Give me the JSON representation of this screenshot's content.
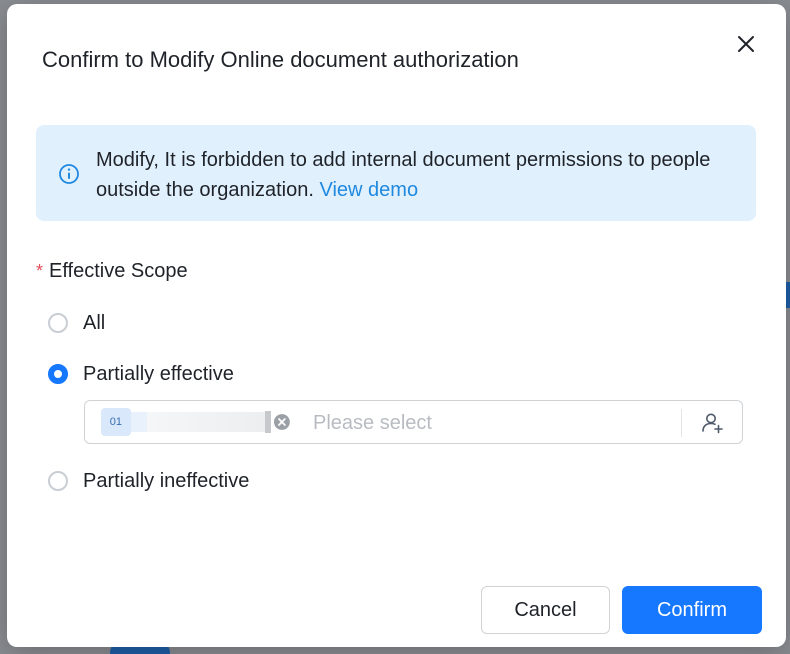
{
  "dialog": {
    "title": "Confirm to Modify Online document authorization",
    "info": {
      "text": "Modify, It is forbidden to add internal document permissions to people outside the organization.",
      "link": "View demo"
    },
    "scope": {
      "required_mark": "*",
      "label": "Effective Scope",
      "options": [
        {
          "label": "All",
          "checked": false
        },
        {
          "label": "Partially effective",
          "checked": true
        },
        {
          "label": "Partially ineffective",
          "checked": false
        }
      ],
      "selector": {
        "tag_avatar": "01",
        "placeholder": "Please select"
      }
    },
    "buttons": {
      "cancel": "Cancel",
      "confirm": "Confirm"
    }
  },
  "colors": {
    "primary": "#1677ff",
    "info_bg": "#e1f0fd",
    "link": "#1f89e0",
    "required": "#e34d59"
  },
  "icons": {
    "close": "close-icon",
    "info": "info-circle-icon",
    "tag_remove": "close-circle-icon",
    "add_person": "add-person-icon"
  }
}
